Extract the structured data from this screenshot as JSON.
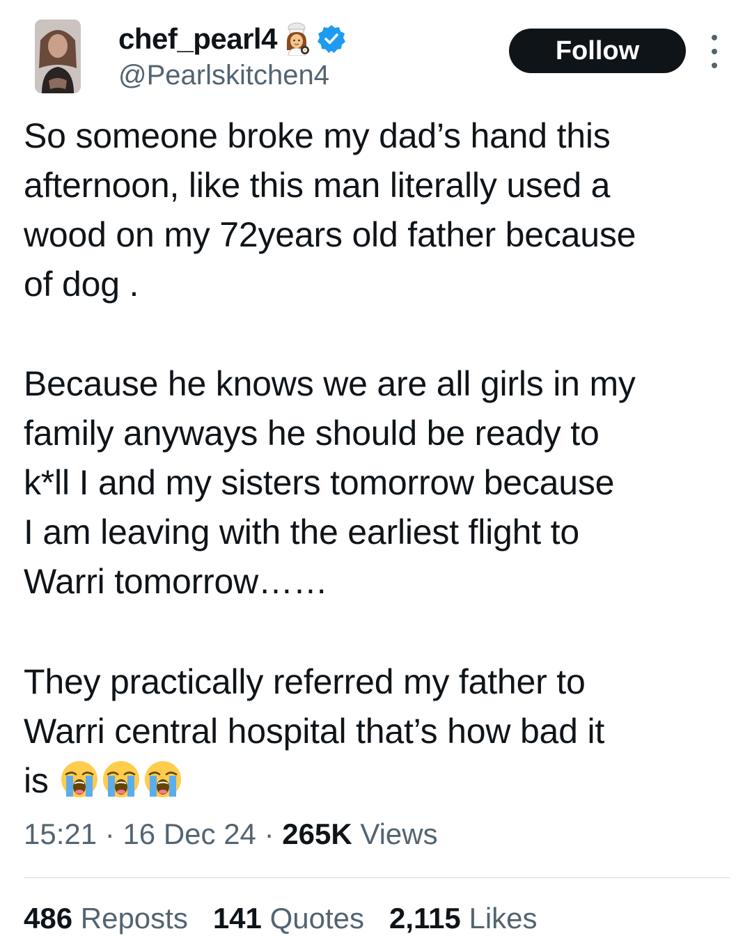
{
  "author": {
    "display_name": "chef_pearl4",
    "handle": "@Pearlskitchen4",
    "badge_icon": "verified-badge-icon",
    "name_emoji": "woman-cook-emoji"
  },
  "header": {
    "follow_label": "Follow",
    "more_icon": "more-options-icon"
  },
  "tweet": {
    "paragraphs": [
      "So someone broke my dad’s hand this\nafternoon, like this man literally used a\nwood on my 72years old father because\nof dog .",
      "Because he knows  we are all girls in my\nfamily anyways he should be ready to\nk*ll I and my sisters tomorrow because\nI am leaving with the earliest flight to\nWarri tomorrow……",
      "They practically referred my father to\nWarri central hospital that’s how bad it\nis"
    ],
    "trailing_emoji": [
      "loudly-crying-face",
      "loudly-crying-face",
      "loudly-crying-face"
    ]
  },
  "meta": {
    "time": "15:21",
    "date": "16 Dec 24",
    "views_count": "265K",
    "views_label": "Views",
    "separator": "·"
  },
  "stats": {
    "reposts_count": "486",
    "reposts_label": "Reposts",
    "quotes_count": "141",
    "quotes_label": "Quotes",
    "likes_count": "2,115",
    "likes_label": "Likes"
  },
  "colors": {
    "text_primary": "#0f1419",
    "text_secondary": "#536471",
    "verified_blue": "#1d9bf0",
    "divider": "#cfd9de"
  }
}
